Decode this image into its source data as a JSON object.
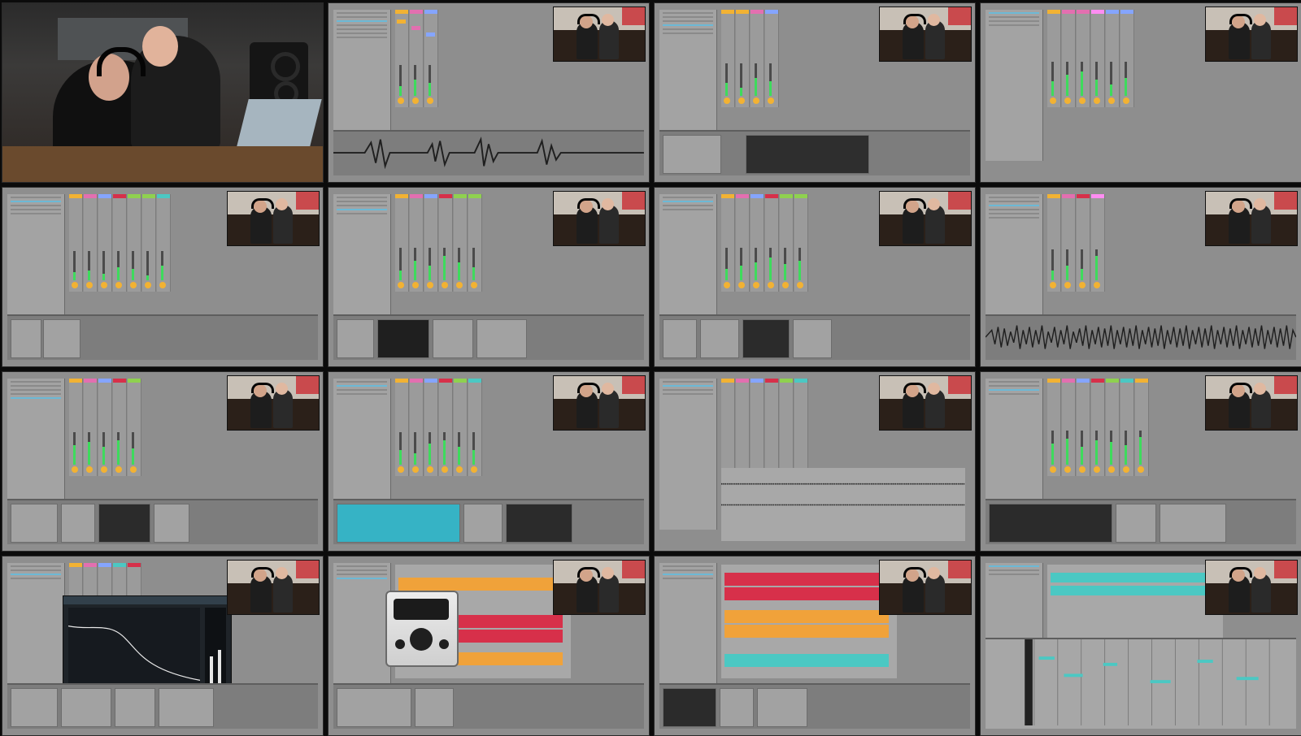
{
  "colors": {
    "background": "#0b0b0b",
    "ableton_gray": "#8e8e8e",
    "green_meter": "#3edb5c",
    "yellow": "#f2b233",
    "red": "#d7304a",
    "orange": "#f0a23a",
    "teal": "#4bc8c3"
  },
  "tiles": [
    {
      "kind": "studio"
    },
    {
      "kind": "ableton-wave"
    },
    {
      "kind": "ableton-device"
    },
    {
      "kind": "ableton-session"
    },
    {
      "kind": "ableton-session"
    },
    {
      "kind": "ableton-device"
    },
    {
      "kind": "ableton-device"
    },
    {
      "kind": "ableton-wave"
    },
    {
      "kind": "ableton-session"
    },
    {
      "kind": "ableton-device"
    },
    {
      "kind": "ableton-arrangement"
    },
    {
      "kind": "ableton-session"
    },
    {
      "kind": "ableton-neutron"
    },
    {
      "kind": "ableton-plugin"
    },
    {
      "kind": "ableton-arrangement-color"
    },
    {
      "kind": "ableton-piano-roll"
    }
  ]
}
